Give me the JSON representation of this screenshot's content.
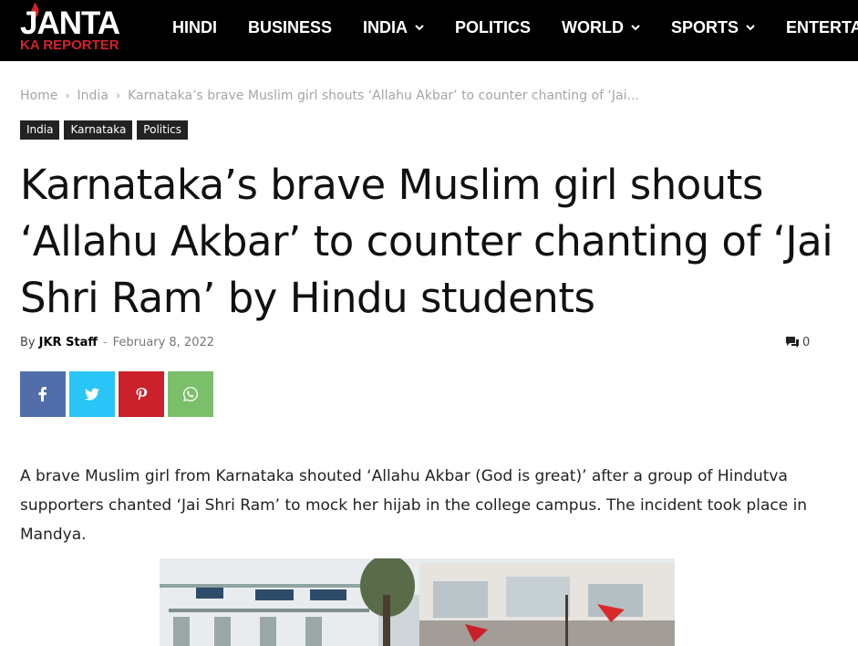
{
  "header": {
    "logo_main": "JANTA",
    "logo_sub": "KA REPORTER",
    "nav": [
      {
        "label": "HINDI",
        "dropdown": false
      },
      {
        "label": "BUSINESS",
        "dropdown": false
      },
      {
        "label": "INDIA",
        "dropdown": true
      },
      {
        "label": "POLITICS",
        "dropdown": false
      },
      {
        "label": "WORLD",
        "dropdown": true
      },
      {
        "label": "SPORTS",
        "dropdown": true
      },
      {
        "label": "ENTERTAI",
        "dropdown": false
      }
    ],
    "colors": {
      "bar": "#000000",
      "logo_accent": "#d2232a"
    }
  },
  "breadcrumb": {
    "items": [
      "Home",
      "India",
      "Karnataka’s brave Muslim girl shouts ‘Allahu Akbar’ to counter chanting of ‘Jai..."
    ],
    "separator": "›"
  },
  "tags": [
    "India",
    "Karnataka",
    "Politics"
  ],
  "article": {
    "title": "Karnataka’s brave Muslim girl shouts ‘Allahu Akbar’ to counter chanting of ‘Jai Shri Ram’ by Hindu students",
    "by_label": "By",
    "author": "JKR Staff",
    "meta_dash": "-",
    "date": "February 8, 2022",
    "comment_count": "0",
    "body": "A brave Muslim girl from Karnataka shouted ‘Allahu Akbar (God is great)’ after a group of Hindutva supporters chanted ‘Jai Shri Ram’ to mock her hijab in the college campus. The incident took place in Mandya."
  },
  "share": [
    {
      "network": "facebook",
      "icon": "facebook-icon",
      "color": "#516eab"
    },
    {
      "network": "twitter",
      "icon": "twitter-icon",
      "color": "#29c5f6"
    },
    {
      "network": "pinterest",
      "icon": "pinterest-icon",
      "color": "#ca212a"
    },
    {
      "network": "whatsapp",
      "icon": "whatsapp-icon",
      "color": "#7bbf6a"
    }
  ]
}
